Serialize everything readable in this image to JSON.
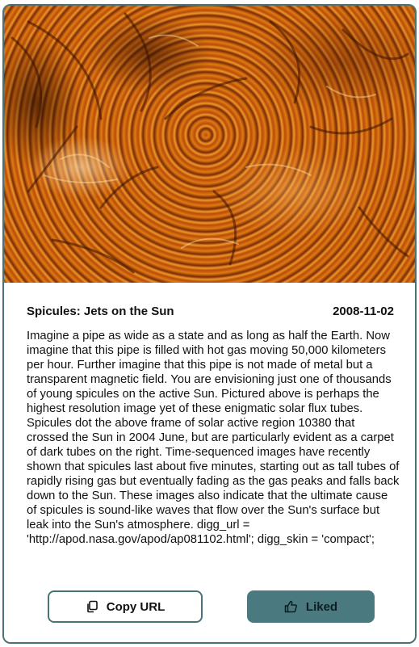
{
  "card": {
    "title": "Spicules: Jets on the Sun",
    "date": "2008-11-02",
    "description": "Imagine a pipe as wide as a state and as long as half the Earth. Now imagine that this pipe is filled with hot gas moving 50,000 kilometers per hour. Further imagine that this pipe is not made of metal but a transparent magnetic field. You are envisioning just one of thousands of young spicules on the active Sun. Pictured above is perhaps the highest resolution image yet of these enigmatic solar flux tubes. Spicules dot the above frame of solar active region 10380 that crossed the Sun in 2004 June, but are particularly evident as a carpet of dark tubes on the right. Time-sequenced images have recently shown that spicules last about five minutes, starting out as tall tubes of rapidly rising gas but eventually fading as the gas peaks and falls back down to the Sun. These images also indicate that the ultimate cause of spicules is sound-like waves that flow over the Sun's surface but leak into the Sun's atmosphere. digg_url = 'http://apod.nasa.gov/apod/ap081102.html'; digg_skin = 'compact';"
  },
  "buttons": {
    "copy_label": "Copy URL",
    "copy_icon": "copy-icon",
    "liked_label": "Liked",
    "liked_icon": "thumbs-up-icon"
  },
  "colors": {
    "accent": "#4a7378",
    "liked_bg": "#4a7a7f"
  }
}
